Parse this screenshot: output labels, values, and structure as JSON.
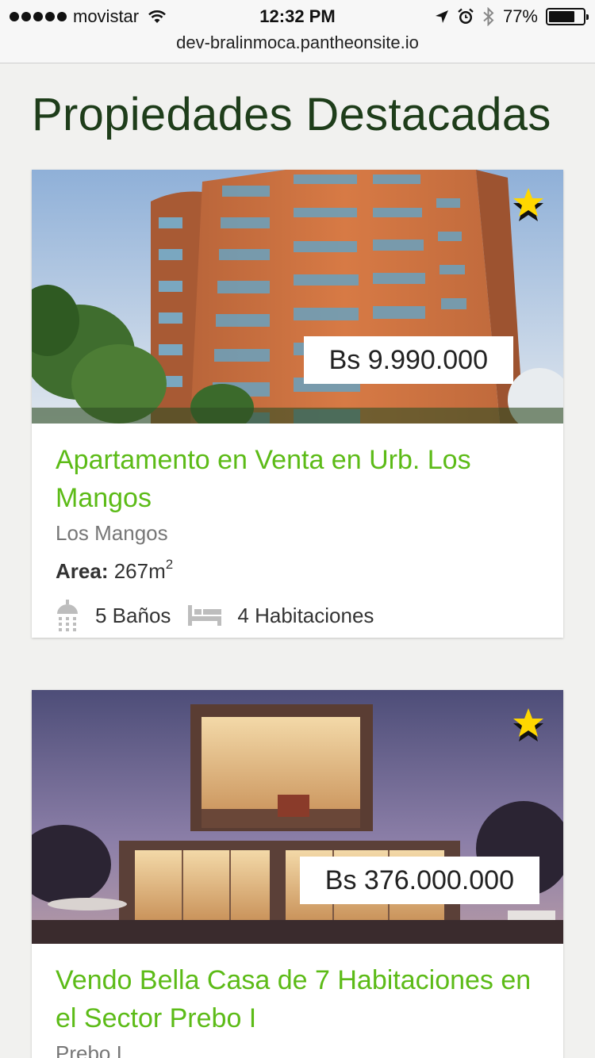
{
  "status_bar": {
    "carrier": "movistar",
    "time": "12:32 PM",
    "battery_percent": "77%",
    "battery_level": 0.77
  },
  "url_bar": {
    "url": "dev-bralinmoca.pantheonsite.io"
  },
  "page": {
    "title": "Propiedades Destacadas"
  },
  "listings": [
    {
      "price": "Bs 9.990.000",
      "title": "Apartamento en Venta en Urb. Los Mangos",
      "location": "Los Mangos",
      "area_label": "Area:",
      "area_value": "267m",
      "area_unit_exp": "2",
      "bathrooms": "5 Baños",
      "bedrooms": "4 Habitaciones",
      "featured": true
    },
    {
      "price": "Bs 376.000.000",
      "title": "Vendo Bella Casa de 7 Habitaciones en el Sector Prebo I",
      "location": "Prebo I",
      "featured": true
    }
  ],
  "colors": {
    "title_green": "#1e3d1a",
    "link_green": "#5cbb17",
    "star_yellow": "#ffd700",
    "background": "#f1f1ef"
  },
  "icons": {
    "favorite": "star-icon",
    "bathroom": "shower-icon",
    "bedroom": "bed-icon",
    "wifi": "wifi-icon",
    "location": "location-arrow-icon",
    "alarm": "alarm-clock-icon",
    "bluetooth": "bluetooth-icon",
    "battery": "battery-icon"
  }
}
